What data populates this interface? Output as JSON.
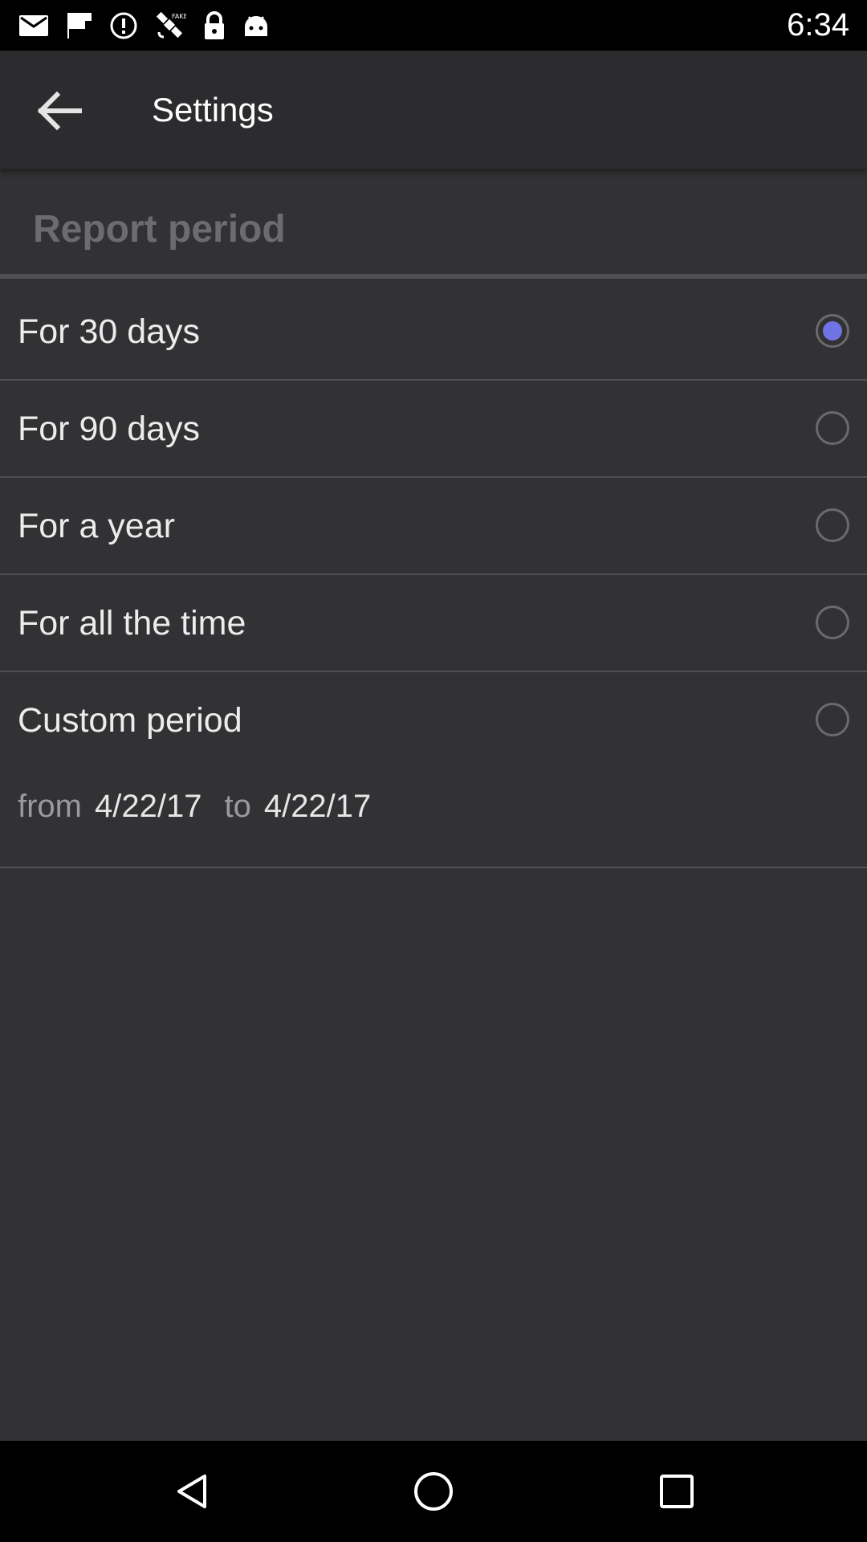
{
  "status_bar": {
    "time": "6:34",
    "icons": [
      "mail-icon",
      "flipboard-icon",
      "alert-circle-icon",
      "satellite-icon",
      "lock-icon",
      "android-icon"
    ]
  },
  "app_bar": {
    "title": "Settings",
    "back_icon": "arrow-left-icon"
  },
  "section": {
    "title": "Report period"
  },
  "options": [
    {
      "label": "For 30 days",
      "selected": true
    },
    {
      "label": "For 90 days",
      "selected": false
    },
    {
      "label": "For a year",
      "selected": false
    },
    {
      "label": "For all the time",
      "selected": false
    },
    {
      "label": "Custom period",
      "selected": false
    }
  ],
  "custom_range": {
    "from_label": "from",
    "from_date": "4/22/17",
    "to_label": "to",
    "to_date": "4/22/17"
  },
  "nav_bar": {
    "icons": [
      "back-triangle-icon",
      "home-circle-icon",
      "recents-square-icon"
    ]
  },
  "colors": {
    "background": "#323234",
    "app_bar": "#2c2c2e",
    "accent": "#6f73e3",
    "section_title": "#6c6c6e"
  }
}
